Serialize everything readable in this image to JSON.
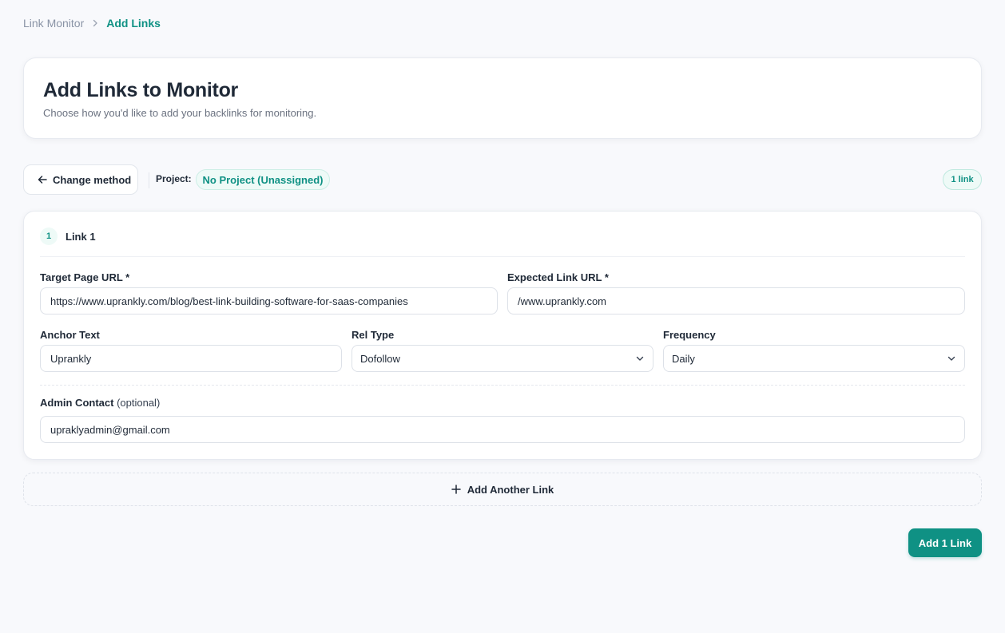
{
  "breadcrumb": {
    "parent": "Link Monitor",
    "current": "Add Links"
  },
  "header": {
    "title": "Add Links to Monitor",
    "subtitle": "Choose how you'd like to add your backlinks for monitoring."
  },
  "toolbar": {
    "change_method_label": "Change method",
    "project_label": "Project:",
    "project_value": "No Project (Unassigned)",
    "link_count": "1 link"
  },
  "link": {
    "number": "1",
    "title": "Link 1",
    "target_url_label": "Target Page URL *",
    "target_url_value": "https://www.uprankly.com/blog/best-link-building-software-for-saas-companies",
    "expected_url_label": "Expected Link URL *",
    "expected_url_value": "/www.uprankly.com",
    "anchor_label": "Anchor Text",
    "anchor_value": "Uprankly",
    "rel_label": "Rel Type",
    "rel_value": "Dofollow",
    "frequency_label": "Frequency",
    "frequency_value": "Daily",
    "admin_label": "Admin Contact",
    "admin_optional": "(optional)",
    "admin_value": "upraklyadmin@gmail.com"
  },
  "actions": {
    "add_another": "Add Another Link",
    "submit": "Add 1 Link"
  },
  "colors": {
    "accent": "#0f9184",
    "accent_light": "#eefaf7",
    "background": "#f8f9fc"
  },
  "icons": {
    "breadcrumb_separator": "chevron-right-icon",
    "back": "arrow-left-icon",
    "select": "chevron-down-icon",
    "add": "plus-icon"
  }
}
